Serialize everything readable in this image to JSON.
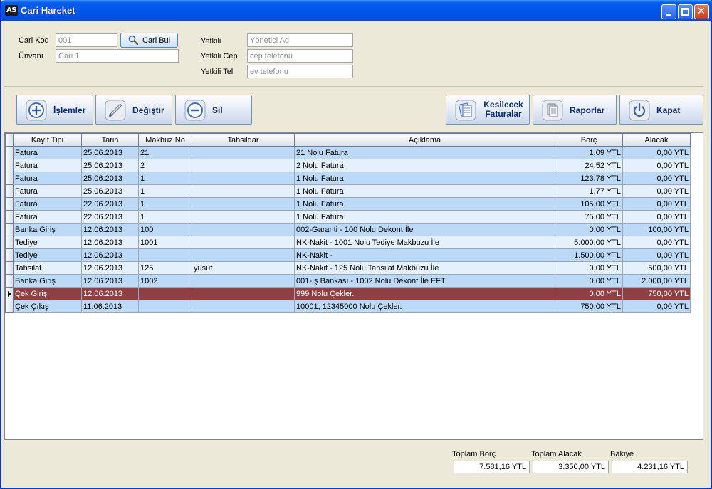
{
  "window": {
    "app_logo": "AS",
    "title": "Cari Hareket"
  },
  "header": {
    "cari_kod_label": "Cari Kod",
    "cari_kod_placeholder": "001",
    "cari_bul_label": "Cari Bul",
    "unvan_label": "Ünvanı",
    "unvan_placeholder": "Cari 1",
    "yetkili_label": "Yetkili",
    "yetkili_placeholder": "Yönetici Adı",
    "yetkili_cep_label": "Yetkili Cep",
    "yetkili_cep_placeholder": "cep telefonu",
    "yetkili_tel_label": "Yetkili Tel",
    "yetkili_tel_placeholder": "ev telefonu"
  },
  "toolbar": {
    "islemler": "İşlemler",
    "degistir": "Değiştir",
    "sil": "Sil",
    "kesilecek_line1": "Kesilecek",
    "kesilecek_line2": "Faturalar",
    "raporlar": "Raporlar",
    "kapat": "Kapat"
  },
  "table": {
    "columns": [
      "Kayıt Tipi",
      "Tarih",
      "Makbuz No",
      "Tahsildar",
      "Açıklama",
      "Borç",
      "Alacak"
    ],
    "rows": [
      [
        "Fatura",
        "25.06.2013",
        "21",
        "",
        "21 Nolu Fatura",
        "1,09 YTL",
        "0,00 YTL"
      ],
      [
        "Fatura",
        "25.06.2013",
        "2",
        "",
        "2 Nolu Fatura",
        "24,52 YTL",
        "0,00 YTL"
      ],
      [
        "Fatura",
        "25.06.2013",
        "1",
        "",
        "1 Nolu Fatura",
        "123,78 YTL",
        "0,00 YTL"
      ],
      [
        "Fatura",
        "25.06.2013",
        "1",
        "",
        "1 Nolu Fatura",
        "1,77 YTL",
        "0,00 YTL"
      ],
      [
        "Fatura",
        "22.06.2013",
        "1",
        "",
        "1 Nolu Fatura",
        "105,00 YTL",
        "0,00 YTL"
      ],
      [
        "Fatura",
        "22.06.2013",
        "1",
        "",
        "1 Nolu Fatura",
        "75,00 YTL",
        "0,00 YTL"
      ],
      [
        "Banka Giriş",
        "12.06.2013",
        "100",
        "",
        "002-Garanti - 100 Nolu Dekont İle",
        "0,00 YTL",
        "100,00 YTL"
      ],
      [
        "Tediye",
        "12.06.2013",
        "1001",
        "",
        "NK-Nakit - 1001 Nolu Tediye Makbuzu İle",
        "5.000,00 YTL",
        "0,00 YTL"
      ],
      [
        "Tediye",
        "12.06.2013",
        "",
        "",
        "NK-Nakit -",
        "1.500,00 YTL",
        "0,00 YTL"
      ],
      [
        "Tahsilat",
        "12.06.2013",
        "125",
        "yusuf",
        "NK-Nakit - 125 Nolu Tahsilat Makbuzu İle",
        "0,00 YTL",
        "500,00 YTL"
      ],
      [
        "Banka Giriş",
        "12.06.2013",
        "1002",
        "",
        "001-İş Bankası - 1002 Nolu Dekont İle EFT",
        "0,00 YTL",
        "2.000,00 YTL"
      ],
      [
        "Çek Giriş",
        "12.06.2013",
        "",
        "",
        "999 Nolu Çekler.",
        "0,00 YTL",
        "750,00 YTL"
      ],
      [
        "Çek Çıkış",
        "11.06.2013",
        "",
        "",
        "10001, 12345000 Nolu Çekler.",
        "750,00 YTL",
        "0,00 YTL"
      ]
    ],
    "selected_row": 11
  },
  "totals": {
    "borc_label": "Toplam Borç",
    "borc_value": "7.581,16 YTL",
    "alacak_label": "Toplam Alacak",
    "alacak_value": "3.350,00 YTL",
    "bakiye_label": "Bakiye",
    "bakiye_value": "4.231,16 YTL"
  }
}
